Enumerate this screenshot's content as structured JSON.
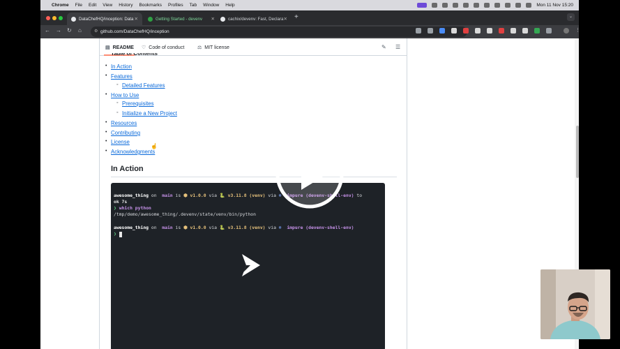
{
  "menubar": {
    "app": "Chrome",
    "items": [
      "File",
      "Edit",
      "View",
      "History",
      "Bookmarks",
      "Profiles",
      "Tab",
      "Window",
      "Help"
    ],
    "clock": "Mon 11 Nov  15:20"
  },
  "tabs": [
    {
      "title": "DataChefHQ/inception: Data",
      "active": true
    },
    {
      "title": "Getting Started - devenv",
      "active": false
    },
    {
      "title": "cachix/devenv: Fast, Declara",
      "active": false
    }
  ],
  "toolbar": {
    "url": "github.com/DataChefHQ/inception"
  },
  "readme_tabs": [
    {
      "label": "README",
      "icon": "book-icon"
    },
    {
      "label": "Code of conduct",
      "icon": "heart-icon"
    },
    {
      "label": "MIT license",
      "icon": "scale-icon"
    }
  ],
  "toc": {
    "heading": "Table of Contents",
    "items": [
      {
        "label": "In Action",
        "level": 1
      },
      {
        "label": "Features",
        "level": 1
      },
      {
        "label": "Detailed Features",
        "level": 2
      },
      {
        "label": "How to Use",
        "level": 1
      },
      {
        "label": "Prerequisites",
        "level": 2
      },
      {
        "label": "Initialize a New Project",
        "level": 2
      },
      {
        "label": "Resources",
        "level": 1
      },
      {
        "label": "Contributing",
        "level": 1
      },
      {
        "label": "License",
        "level": 1
      },
      {
        "label": "Acknowledgments",
        "level": 1
      }
    ]
  },
  "section_heading": "In Action",
  "terminal": {
    "l1": {
      "name": "awesome_thing",
      "on": " on ",
      "branch_icon": "",
      "branch": " main",
      "is": " is ",
      "pkg": "v1.0.0",
      "via1": " via ",
      "py": "v3.11.8 (venv)",
      "via2": " via ",
      "env": "impure (devenv-shell-env)",
      "to": " to"
    },
    "l2": "ok 7s",
    "l3_prompt": "❯",
    "l3_cmd": "which python",
    "l4": "/tmp/demo/awesome_thing/.devenv/state/venv/bin/python",
    "l6": {
      "name": "awesome_thing",
      "on": " on ",
      "branch_icon": "",
      "branch": " main",
      "is": " is ",
      "pkg": "v1.0.0",
      "via1": " via ",
      "py": "v3.11.8 (venv)",
      "via2": " via ",
      "env": "impure (devenv-shell-env)"
    },
    "l7_prompt": "❯"
  },
  "colors": {
    "link": "#0969da",
    "terminal_bg": "#1e2227",
    "tab_underline": "#fd8c73"
  }
}
